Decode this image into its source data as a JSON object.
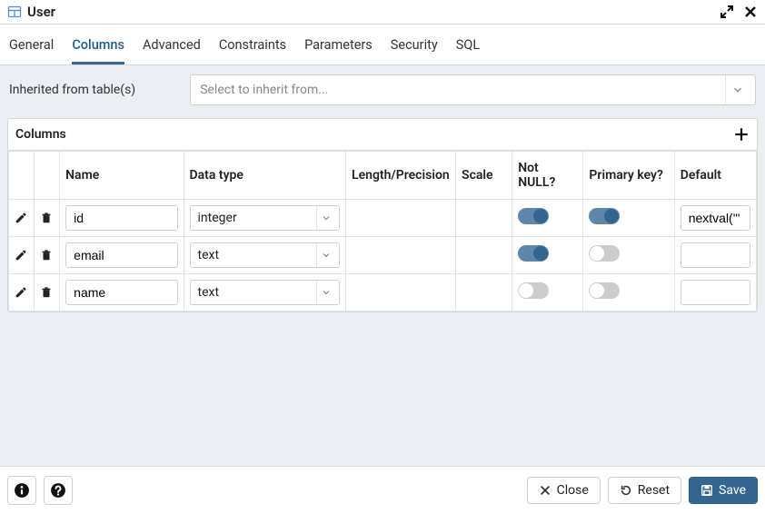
{
  "window": {
    "title": "User"
  },
  "tabs": [
    {
      "label": "General",
      "active": false
    },
    {
      "label": "Columns",
      "active": true
    },
    {
      "label": "Advanced",
      "active": false
    },
    {
      "label": "Constraints",
      "active": false
    },
    {
      "label": "Parameters",
      "active": false
    },
    {
      "label": "Security",
      "active": false
    },
    {
      "label": "SQL",
      "active": false
    }
  ],
  "inherit": {
    "label": "Inherited from table(s)",
    "placeholder": "Select to inherit from..."
  },
  "columns_panel": {
    "title": "Columns",
    "headers": {
      "name": "Name",
      "data_type": "Data type",
      "length": "Length/Precision",
      "scale": "Scale",
      "not_null": "Not NULL?",
      "primary_key": "Primary key?",
      "default": "Default"
    },
    "rows": [
      {
        "name": "id",
        "data_type": "integer",
        "length": "",
        "scale": "",
        "not_null": true,
        "primary_key": true,
        "default": "nextval('\""
      },
      {
        "name": "email",
        "data_type": "text",
        "length": "",
        "scale": "",
        "not_null": true,
        "primary_key": false,
        "default": ""
      },
      {
        "name": "name",
        "data_type": "text",
        "length": "",
        "scale": "",
        "not_null": false,
        "primary_key": false,
        "default": ""
      }
    ]
  },
  "footer": {
    "close": "Close",
    "reset": "Reset",
    "save": "Save"
  }
}
